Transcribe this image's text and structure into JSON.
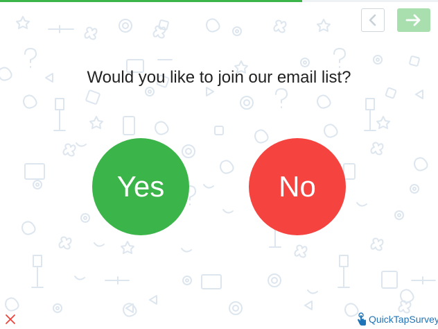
{
  "progress": {
    "fraction": 0.69,
    "color": "#3bb54a"
  },
  "navigation": {
    "back_icon": "chevron-left-icon",
    "next_icon": "arrow-right-icon"
  },
  "survey": {
    "question": "Would you like to join our email list?",
    "answers": [
      {
        "label": "Yes",
        "color": "#3bb54a"
      },
      {
        "label": "No",
        "color": "#f5433f"
      }
    ]
  },
  "footer": {
    "close_icon": "close-icon",
    "brand_name": "QuickTapSurvey",
    "brand_icon": "hand-pointer-icon"
  },
  "theme": {
    "pattern_color": "#dde6ef"
  }
}
